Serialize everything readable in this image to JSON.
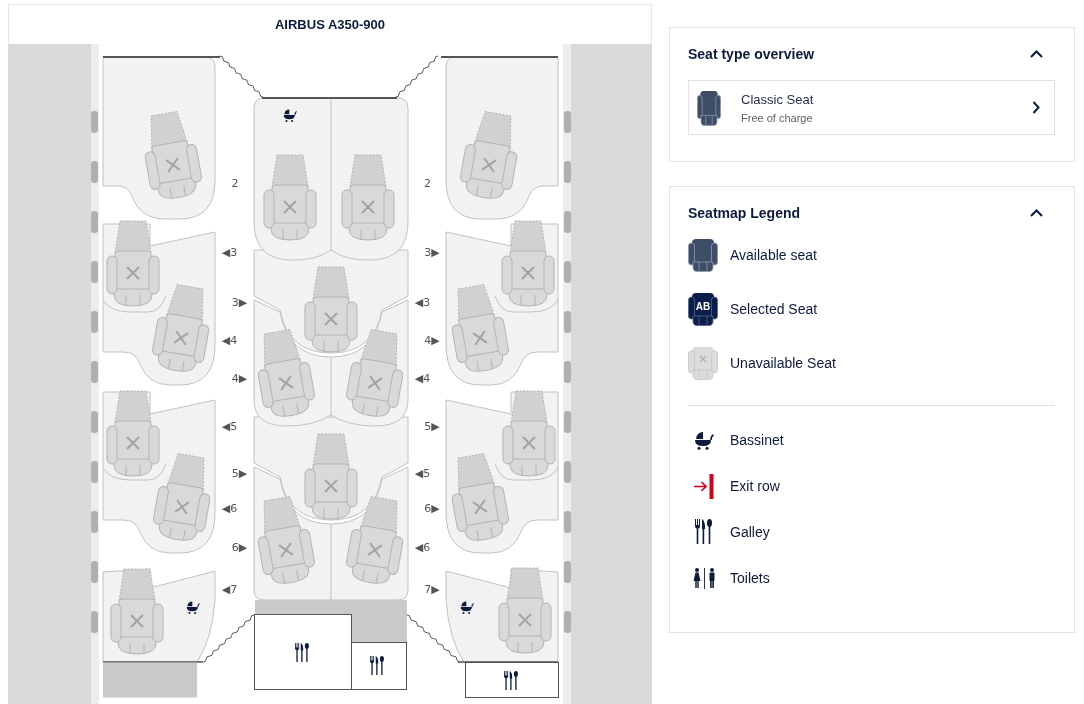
{
  "seatmap": {
    "title": "AIRBUS A350-900",
    "seats": [
      {
        "available": false,
        "selected": false
      },
      {
        "available": false,
        "selected": false
      },
      {
        "available": false,
        "selected": false
      },
      {
        "available": false,
        "selected": false
      },
      {
        "available": false,
        "selected": false
      },
      {
        "available": false,
        "selected": false
      },
      {
        "available": false,
        "selected": false
      },
      {
        "available": false,
        "selected": false
      },
      {
        "available": false,
        "selected": false
      },
      {
        "available": false,
        "selected": false
      },
      {
        "available": false,
        "selected": false
      },
      {
        "available": false,
        "selected": false
      },
      {
        "available": false,
        "selected": false
      },
      {
        "available": false,
        "selected": false
      },
      {
        "available": false,
        "selected": false
      },
      {
        "available": false,
        "selected": false
      },
      {
        "available": false,
        "selected": false
      },
      {
        "available": false,
        "selected": false
      },
      {
        "available": false,
        "selected": false
      },
      {
        "available": false,
        "selected": false
      }
    ],
    "row_labels": [
      "2",
      "2",
      "◀3",
      "3▶",
      "3▶",
      "◀3",
      "◀4",
      "4▶",
      "4▶",
      "◀4",
      "◀5",
      "5▶",
      "5▶",
      "◀5",
      "◀6",
      "6▶",
      "6▶",
      "◀6",
      "◀7",
      "7▶"
    ]
  },
  "seat_types": {
    "title": "Seat type overview",
    "expanded": true,
    "items": [
      {
        "name": "Classic Seat",
        "price": "Free of charge"
      }
    ]
  },
  "legend": {
    "title": "Seatmap Legend",
    "expanded": true,
    "seat_states": [
      {
        "kind": "available",
        "label": "Available seat"
      },
      {
        "kind": "selected",
        "label": "Selected Seat",
        "code": "AB"
      },
      {
        "kind": "unavailable",
        "label": "Unavailable Seat"
      }
    ],
    "facilities": [
      {
        "kind": "bassinet",
        "label": "Bassinet"
      },
      {
        "kind": "exit",
        "label": "Exit row"
      },
      {
        "kind": "galley",
        "label": "Galley"
      },
      {
        "kind": "toilets",
        "label": "Toilets"
      }
    ]
  }
}
